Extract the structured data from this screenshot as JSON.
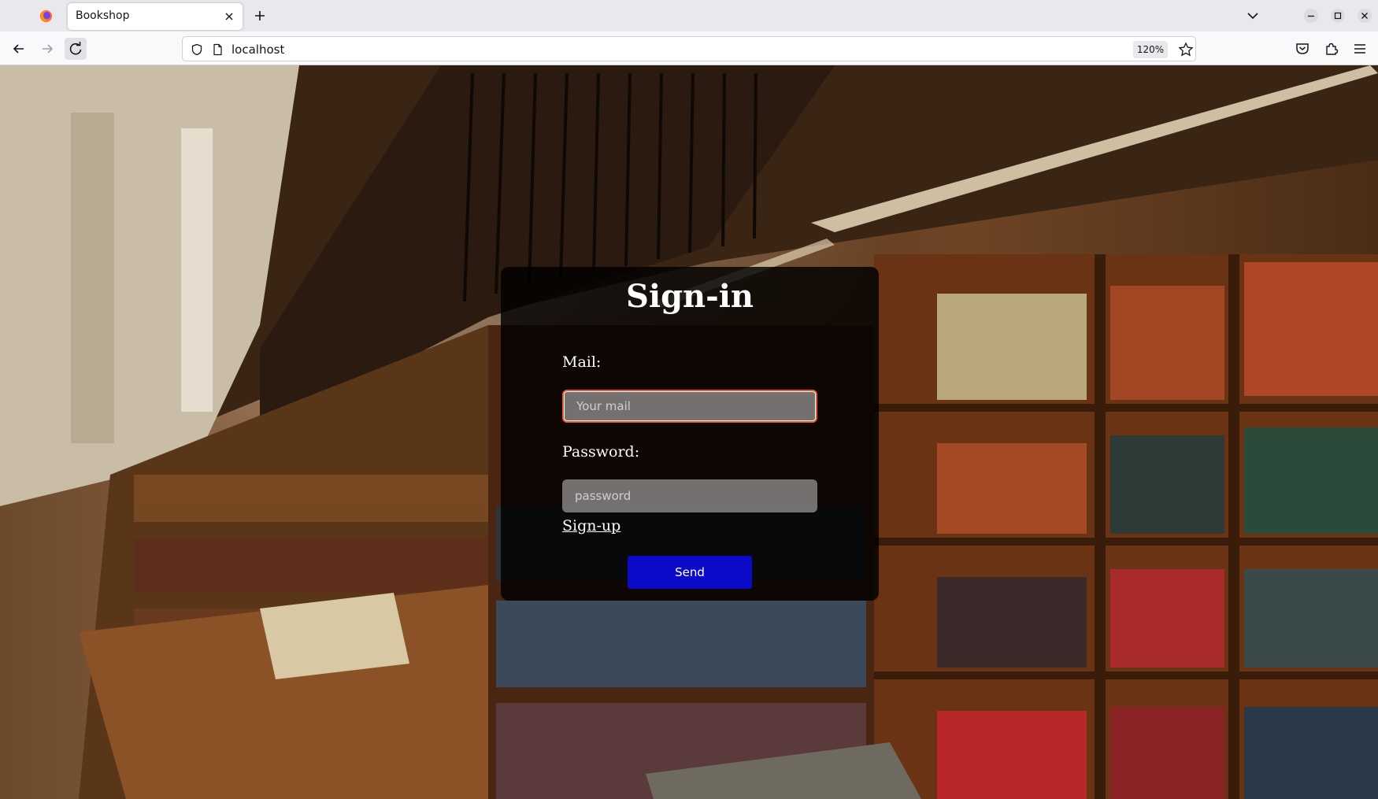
{
  "browser": {
    "tab_title": "Bookshop",
    "url": "localhost",
    "zoom": "120%"
  },
  "signin": {
    "title": "Sign-in",
    "mail_label": "Mail:",
    "mail_placeholder": "Your mail",
    "mail_value": "",
    "password_label": "Password:",
    "password_placeholder": "password",
    "password_value": "",
    "signup_link": "Sign-up",
    "send_label": "Send"
  },
  "colors": {
    "send_button": "#0a0ac8",
    "focus_ring": "#e85a2b"
  },
  "icons": {
    "browser_logo": "firefox-icon",
    "tab_close": "close-icon",
    "new_tab": "plus-icon",
    "tab_list": "chevron-down-icon",
    "back": "arrow-left-icon",
    "forward": "arrow-right-icon",
    "reload": "reload-icon",
    "tracking": "shield-icon",
    "page_info": "page-icon",
    "bookmark": "star-icon",
    "pocket": "pocket-icon",
    "extensions": "puzzle-icon",
    "menu": "hamburger-icon"
  }
}
